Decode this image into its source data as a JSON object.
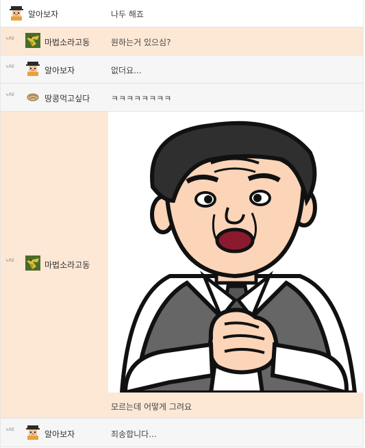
{
  "re_mark": "↳RE",
  "comments": [
    {
      "nickname": "알아보자",
      "text": "나두 해죠",
      "avatar": "pixel-man-avatar-icon"
    },
    {
      "nickname": "마법소라고동",
      "text": "원하는거 있으심?",
      "avatar": "conch-shell-avatar-icon"
    },
    {
      "nickname": "알아보자",
      "text": "없더요...",
      "avatar": "pixel-man-avatar-icon"
    },
    {
      "nickname": "땅콩먹고싶다",
      "text": "ㅋㅋㅋㅋㅋㅋㅋㅋ",
      "avatar": "peanut-avatar-icon"
    },
    {
      "nickname": "마법소라고동",
      "text": "모르는데 어떻게 그려요",
      "avatar": "conch-shell-avatar-icon",
      "image": "cartoon-man-clasped-hands"
    },
    {
      "nickname": "알아보자",
      "text": "죄송합니다...",
      "avatar": "pixel-man-avatar-icon"
    }
  ],
  "colors": {
    "peach_bg": "#fde7d5",
    "gray_bg": "#f6f6f6",
    "border": "#e3e3e3"
  }
}
